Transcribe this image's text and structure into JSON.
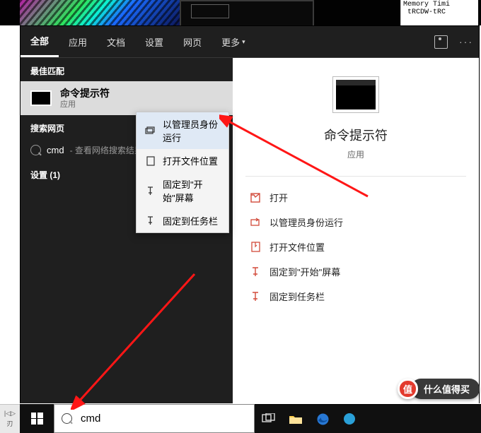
{
  "notepad_snippet": "Memory Timi\n tRCDW-tRC",
  "search": {
    "tabs": {
      "all": "全部",
      "apps": "应用",
      "docs": "文档",
      "settings": "设置",
      "web": "网页",
      "more": "更多"
    },
    "sections": {
      "best": "最佳匹配",
      "web": "搜索网页",
      "settings_count": "设置 (1)"
    },
    "best": {
      "title": "命令提示符",
      "subtitle": "应用"
    },
    "web_row": {
      "term": "cmd",
      "suffix": " - 查看网络搜索结果"
    },
    "detail": {
      "title": "命令提示符",
      "subtitle": "应用"
    },
    "ctx": {
      "run_admin": "以管理员身份运行",
      "open_loc": "打开文件位置",
      "pin_start": "固定到\"开始\"屏幕",
      "pin_tb": "固定到任务栏"
    },
    "actions": {
      "open": "打开",
      "run_admin": "以管理员身份运行",
      "open_loc": "打开文件位置",
      "pin_start": "固定到\"开始\"屏幕",
      "pin_tb": "固定到任务栏"
    }
  },
  "taskbar": {
    "query": "cmd",
    "mini_top": "|◁▷",
    "mini_bottom": "刃"
  },
  "watermark": {
    "badge": "值",
    "label": "什么值得买"
  }
}
